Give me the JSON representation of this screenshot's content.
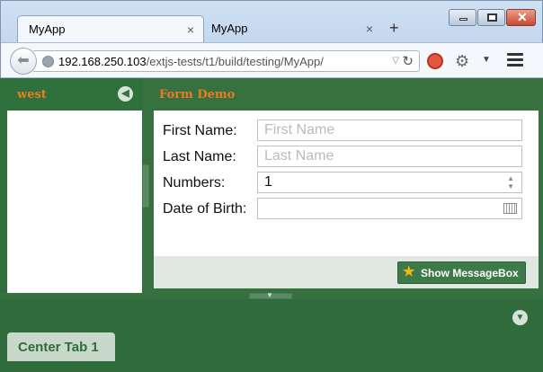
{
  "browser": {
    "tabs": [
      {
        "title": "MyApp",
        "close": "×"
      },
      {
        "title": "MyApp",
        "close": "×"
      }
    ],
    "new_tab": "+",
    "url": {
      "host": "192.168.250.103",
      "path": "/extjs-tests/t1/build/testing/MyApp/"
    },
    "icons": [
      "back-icon",
      "globe-icon",
      "dropdown-icon",
      "reload-icon",
      "noscript-icon",
      "gear-icon",
      "menu-icon"
    ]
  },
  "west": {
    "title": "west",
    "collapse_icon": "chevron-left-icon"
  },
  "form": {
    "title": "Form Demo",
    "fields": {
      "first_name": {
        "label": "First Name:",
        "placeholder": "First Name",
        "value": ""
      },
      "last_name": {
        "label": "Last Name:",
        "placeholder": "Last Name",
        "value": ""
      },
      "numbers": {
        "label": "Numbers:",
        "value": "1"
      },
      "dob": {
        "label": "Date of Birth:",
        "value": ""
      }
    },
    "button": {
      "label": "Show MessageBox",
      "icon": "star-icon"
    }
  },
  "south": {
    "tab_label": "Center Tab 1",
    "collapse_icon": "chevron-down-icon"
  },
  "colors": {
    "panel_green": "#36713f",
    "title_orange": "#f07b1f",
    "button_green": "#3d7a47"
  }
}
